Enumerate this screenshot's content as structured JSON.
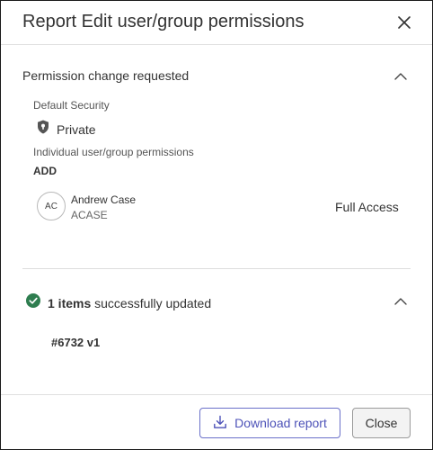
{
  "dialog": {
    "title": "Report Edit user/group permissions",
    "close_icon": "close-icon"
  },
  "permission_section": {
    "title": "Permission change requested",
    "collapse_icon": "chevron-up-icon",
    "default_security_label": "Default Security",
    "default_security_value": "Private",
    "default_security_icon": "shield-icon",
    "individual_label": "Individual user/group permissions",
    "add_label": "ADD",
    "user": {
      "initials": "AC",
      "name": "Andrew Case",
      "id": "ACASE",
      "access": "Full Access"
    }
  },
  "result_section": {
    "count_text": "1 items",
    "status_text": "successfully updated",
    "status_icon": "check-circle-icon",
    "status_color": "#2e7d4f",
    "collapse_icon": "chevron-up-icon",
    "document_ref": "#6732 v1"
  },
  "footer": {
    "download_label": "Download report",
    "download_icon": "download-icon",
    "close_label": "Close",
    "accent_color": "#4d52b8"
  }
}
